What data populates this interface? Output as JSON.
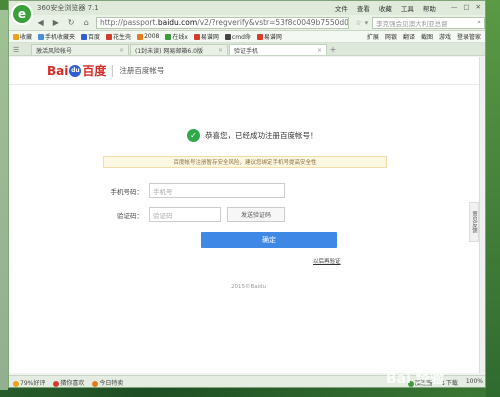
{
  "browser": {
    "title": "360安全浏览器 7.1",
    "logo_letter": "e",
    "menu": [
      "文件",
      "查看",
      "收藏",
      "工具",
      "帮助"
    ],
    "window_buttons": [
      "—",
      "□",
      "✕"
    ],
    "address": {
      "prefix": "http://passport.",
      "domain": "baidu.com",
      "suffix": "/v2/?regverify&vstr=53f8c0049b7550d0a1e5t"
    },
    "search_placeholder": "李克强会见澳大利亚总督"
  },
  "bookmarks": {
    "items": [
      {
        "label": "收藏",
        "color": "#e8a21c"
      },
      {
        "label": "手机收藏夹",
        "color": "#4a90d9"
      },
      {
        "label": "百度",
        "color": "#2f5fd3"
      },
      {
        "label": "花生壳",
        "color": "#d63b2b"
      },
      {
        "label": "2008",
        "color": "#e57b1c"
      },
      {
        "label": "在线x",
        "color": "#3c9c3c"
      },
      {
        "label": "易谱网",
        "color": "#d63b2b"
      },
      {
        "label": "cmd命",
        "color": "#444444"
      },
      {
        "label": "易谱网",
        "color": "#d63b2b"
      }
    ],
    "right": [
      "扩展",
      "网银",
      "翻译",
      "截图",
      "游戏",
      "登录管家"
    ]
  },
  "tabs": [
    {
      "label": "激活风险帐号",
      "active": false
    },
    {
      "label": "(1封未读) 网易邮箱6.0版",
      "active": false
    },
    {
      "label": "验证手机",
      "active": true
    }
  ],
  "page": {
    "brand": {
      "left": "Bai",
      "du": "du",
      "right": "百度"
    },
    "header_title": "注册百度帐号",
    "success_message": "恭喜您，已经成功注册百度帐号！",
    "notice": "百度帐号注册暂存安全风险，建议您绑定手机号提高安全性",
    "phone_label": "手机号码：",
    "phone_placeholder": "手机号",
    "code_label": "验证码：",
    "code_placeholder": "验证码",
    "send_code": "发送验证码",
    "confirm": "确定",
    "skip": "以后再验证",
    "copyright": "2015©Baidu",
    "feedback": "意见反馈"
  },
  "statusbar": {
    "left": [
      "79%好评",
      "猜你喜欢",
      "今日特卖"
    ],
    "right": [
      "加速器",
      "下载",
      "100%"
    ]
  },
  "watermark": "Bai 经验",
  "colors": {
    "accent": "#3f88e6",
    "success": "#2fa84a",
    "brand_red": "#d62b27",
    "brand_blue": "#2f5fd3"
  }
}
